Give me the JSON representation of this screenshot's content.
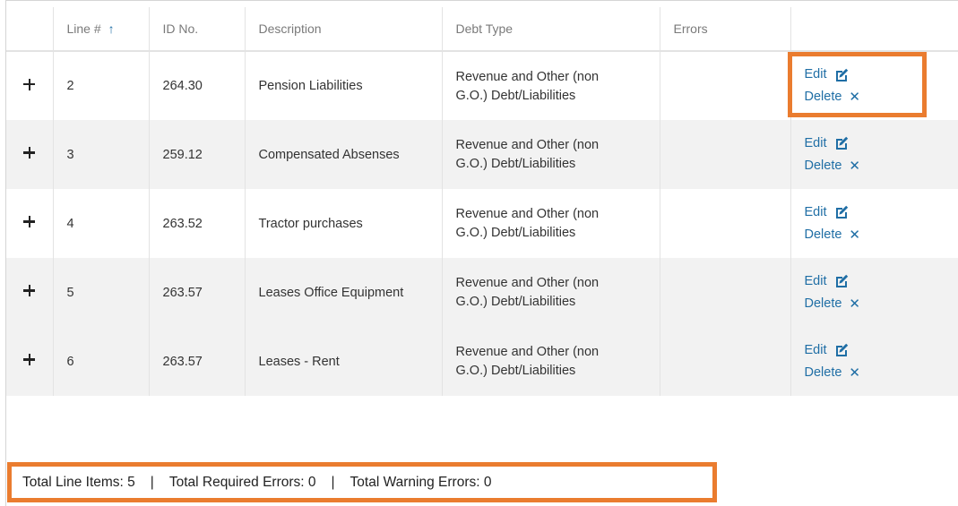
{
  "table": {
    "columns": [
      {
        "key": "expand",
        "label": ""
      },
      {
        "key": "line",
        "label": "Line #",
        "sorted": "ascending"
      },
      {
        "key": "id",
        "label": "ID No."
      },
      {
        "key": "description",
        "label": "Description"
      },
      {
        "key": "debt_type",
        "label": "Debt Type"
      },
      {
        "key": "errors",
        "label": "Errors"
      },
      {
        "key": "actions",
        "label": ""
      }
    ],
    "sort_icon": "arrow-up-icon",
    "rows": [
      {
        "line": "2",
        "id": "264.30",
        "description": "Pension Liabilities",
        "debt_type_1": "Revenue and Other (non",
        "debt_type_2": "G.O.) Debt/Liabilities",
        "errors": "",
        "edit": "Edit",
        "delete": "Delete"
      },
      {
        "line": "3",
        "id": "259.12",
        "description": "Compensated Absenses",
        "debt_type_1": "Revenue and Other (non",
        "debt_type_2": "G.O.) Debt/Liabilities",
        "errors": "",
        "edit": "Edit",
        "delete": "Delete"
      },
      {
        "line": "4",
        "id": "263.52",
        "description": "Tractor purchases",
        "debt_type_1": "Revenue and Other (non",
        "debt_type_2": "G.O.) Debt/Liabilities",
        "errors": "",
        "edit": "Edit",
        "delete": "Delete"
      },
      {
        "line": "5",
        "id": "263.57",
        "description": "Leases Office Equipment",
        "debt_type_1": "Revenue and Other (non",
        "debt_type_2": "G.O.) Debt/Liabilities",
        "errors": "",
        "edit": "Edit",
        "delete": "Delete"
      },
      {
        "line": "6",
        "id": "263.57",
        "description": "Leases - Rent",
        "debt_type_1": "Revenue and Other (non",
        "debt_type_2": "G.O.) Debt/Liabilities",
        "errors": "",
        "edit": "Edit",
        "delete": "Delete"
      }
    ],
    "row_icons": {
      "expand": "plus-icon",
      "edit": "edit-icon",
      "delete": "close-icon"
    }
  },
  "footer": {
    "total_line_items": "Total Line Items: 5",
    "separator": "|",
    "total_required_errors": "Total Required Errors: 0",
    "total_warning_errors": "Total Warning Errors: 0"
  },
  "colors": {
    "link": "#1f6ea5",
    "highlight": "#ea7c2f",
    "row_alt": "#f2f2f2",
    "header_text": "#7a7a7a"
  }
}
